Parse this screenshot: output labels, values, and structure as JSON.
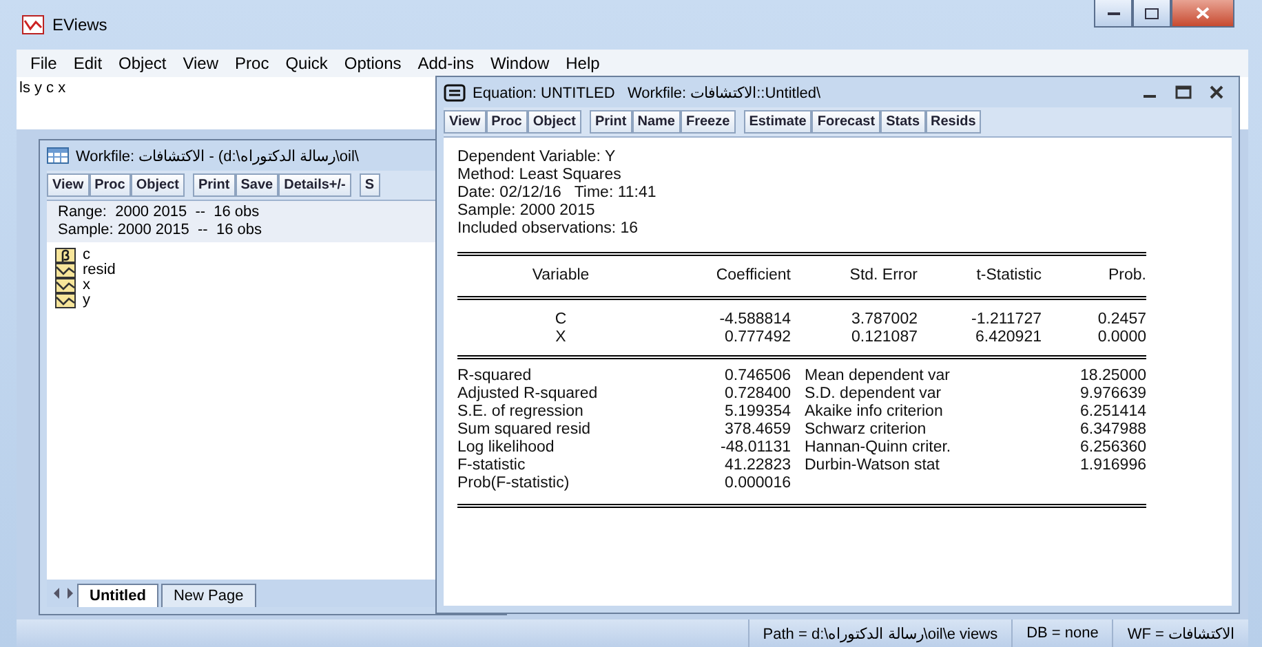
{
  "window": {
    "title": "EViews"
  },
  "menu": [
    "File",
    "Edit",
    "Object",
    "View",
    "Proc",
    "Quick",
    "Options",
    "Add-ins",
    "Window",
    "Help"
  ],
  "command": "ls y c x",
  "workfile_window": {
    "title": "Workfile: الاكتشافات - (d:\\رسالة الدكتوراه\\oil\\",
    "toolbar": [
      [
        "View",
        "Proc",
        "Object"
      ],
      [
        "Print",
        "Save",
        "Details+/-"
      ],
      [
        "S"
      ]
    ],
    "range": "Range:  2000 2015  --  16 obs",
    "sample": "Sample: 2000 2015  --  16 obs",
    "objects": [
      {
        "name": "c",
        "kind": "coef"
      },
      {
        "name": "resid",
        "kind": "series"
      },
      {
        "name": "x",
        "kind": "series"
      },
      {
        "name": "y",
        "kind": "series"
      }
    ],
    "tabs": [
      {
        "label": "Untitled",
        "selected": true
      },
      {
        "label": "New Page",
        "selected": false
      }
    ]
  },
  "equation_window": {
    "title": "Equation: UNTITLED   Workfile: الاكتشافات::Untitled\\",
    "toolbar": [
      [
        "View",
        "Proc",
        "Object"
      ],
      [
        "Print",
        "Name",
        "Freeze"
      ],
      [
        "Estimate",
        "Forecast",
        "Stats",
        "Resids"
      ]
    ],
    "header_lines": [
      "Dependent Variable: Y",
      "Method: Least Squares",
      "Date: 02/12/16   Time: 11:41",
      "Sample: 2000 2015",
      "Included observations: 16"
    ],
    "table": {
      "columns": [
        "Variable",
        "Coefficient",
        "Std. Error",
        "t-Statistic",
        "Prob."
      ],
      "rows": [
        {
          "variable": "C",
          "values": [
            "-4.588814",
            "3.787002",
            "-1.211727",
            "0.2457"
          ]
        },
        {
          "variable": "X",
          "values": [
            "0.777492",
            "0.121087",
            "6.420921",
            "0.0000"
          ]
        }
      ]
    },
    "stats": [
      {
        "label": "R-squared",
        "value": "0.746506",
        "label_2": "Mean dependent var",
        "value_2": "18.25000"
      },
      {
        "label": "Adjusted R-squared",
        "value": "0.728400",
        "label_2": "S.D. dependent var",
        "value_2": "9.976639"
      },
      {
        "label": "S.E. of regression",
        "value": "5.199354",
        "label_2": "Akaike info criterion",
        "value_2": "6.251414"
      },
      {
        "label": "Sum squared resid",
        "value": "378.4659",
        "label_2": "Schwarz criterion",
        "value_2": "6.347988"
      },
      {
        "label": "Log likelihood",
        "value": "-48.01131",
        "label_2": "Hannan-Quinn criter.",
        "value_2": "6.256360"
      },
      {
        "label": "F-statistic",
        "value": "41.22823",
        "label_2": "Durbin-Watson stat",
        "value_2": "1.916996"
      },
      {
        "label": "Prob(F-statistic)",
        "value": "0.000016"
      }
    ]
  },
  "status_bar": {
    "path": "Path = d:\\رسالة الدكتوراه\\oil\\e views",
    "db": "DB = none",
    "wf": "WF = الاكتشافات"
  }
}
